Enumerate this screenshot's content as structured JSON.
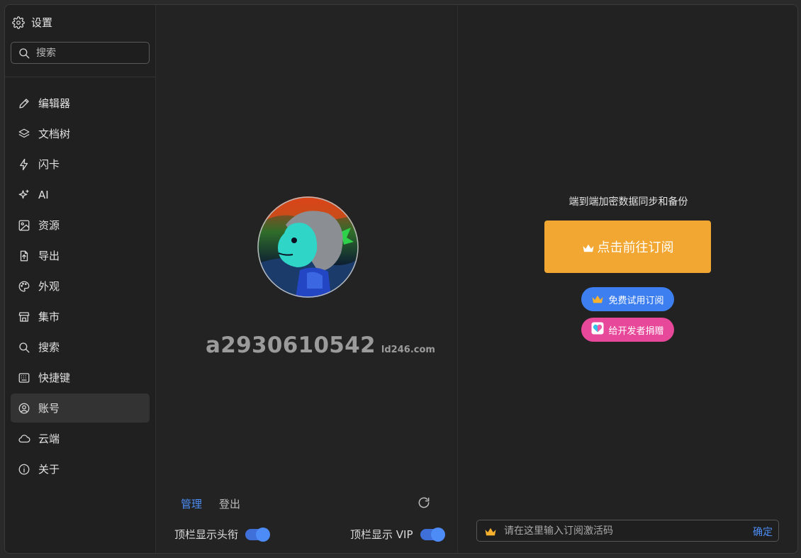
{
  "sidebar": {
    "title": "设置",
    "search_placeholder": "搜索",
    "items": [
      {
        "label": "编辑器",
        "icon": "pencil-icon"
      },
      {
        "label": "文档树",
        "icon": "layers-icon"
      },
      {
        "label": "闪卡",
        "icon": "lightning-icon"
      },
      {
        "label": "AI",
        "icon": "sparkles-icon"
      },
      {
        "label": "资源",
        "icon": "image-icon"
      },
      {
        "label": "导出",
        "icon": "export-file-icon"
      },
      {
        "label": "外观",
        "icon": "palette-icon"
      },
      {
        "label": "集市",
        "icon": "store-icon"
      },
      {
        "label": "搜索",
        "icon": "search-icon"
      },
      {
        "label": "快捷键",
        "icon": "keyboard-icon"
      },
      {
        "label": "账号",
        "icon": "account-icon",
        "active": true
      },
      {
        "label": "云端",
        "icon": "cloud-icon"
      },
      {
        "label": "关于",
        "icon": "info-icon"
      }
    ]
  },
  "account": {
    "username": "a2930610542",
    "domain": "ld246.com",
    "manage_label": "管理",
    "logout_label": "登出",
    "show_title_label": "顶栏显示头衔",
    "show_vip_label": "顶栏显示 VIP"
  },
  "subscription": {
    "title": "端到端加密数据同步和备份",
    "subscribe_label": "点击前往订阅",
    "trial_label": "免费试用订阅",
    "donate_label": "给开发者捐赠",
    "code_placeholder": "请在这里输入订阅激活码",
    "confirm_label": "确定"
  },
  "colors": {
    "accent": "#4c8df6",
    "subscribe": "#f1a731",
    "trial": "#3d7ff0",
    "donate": "#e8489a"
  }
}
